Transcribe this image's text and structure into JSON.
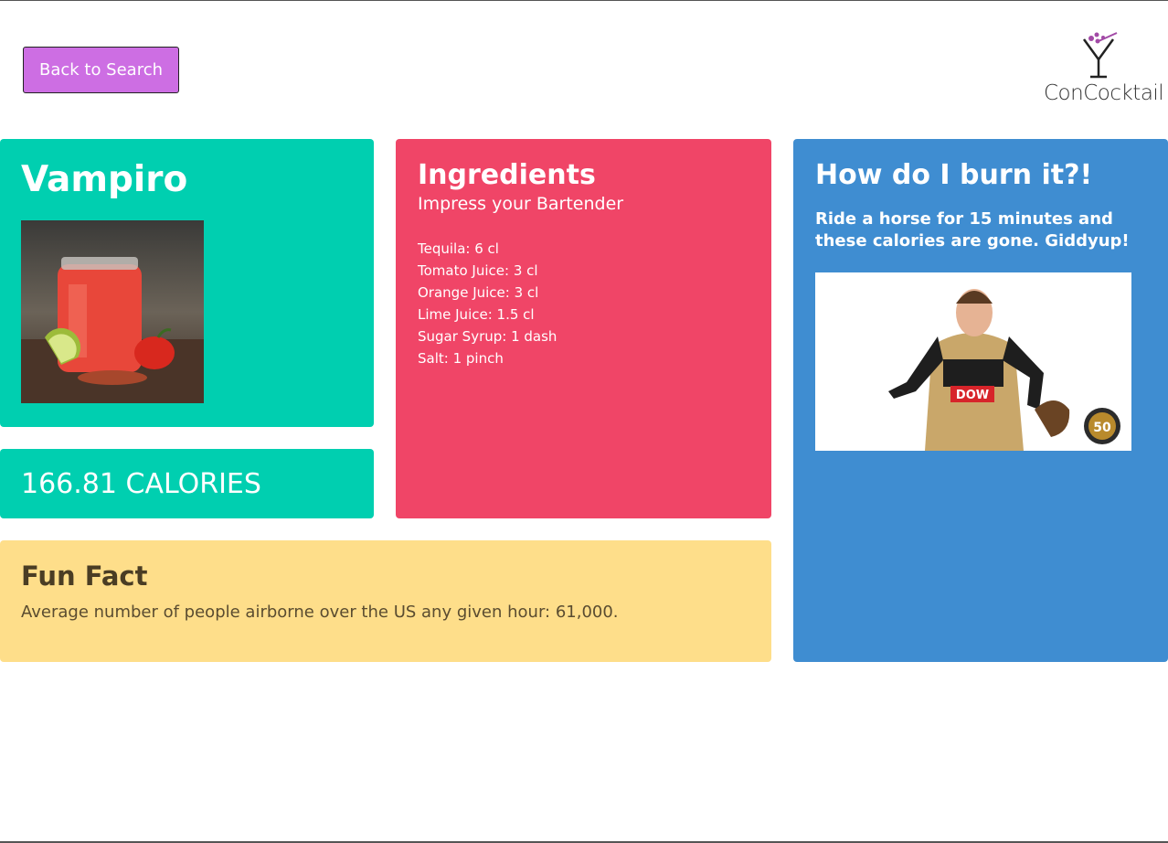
{
  "header": {
    "back_label": "Back to Search",
    "logo_text": "ConCocktail"
  },
  "drink": {
    "name": "Vampiro",
    "calories": "166.81 CALORIES"
  },
  "ingredients": {
    "title": "Ingredients",
    "subtitle": "Impress your Bartender",
    "items": [
      "Tequila: 6 cl",
      "Tomato Juice: 3 cl",
      "Orange Juice: 3 cl",
      "Lime Juice: 1.5 cl",
      "Sugar Syrup: 1 dash",
      "Salt: 1 pinch"
    ]
  },
  "burn": {
    "title": "How do I burn it?!",
    "text": "Ride a horse for 15 minutes and these calories are gone. Giddyup!",
    "badge_number": "50"
  },
  "fun_fact": {
    "title": "Fun Fact",
    "text": "Average number of people airborne over the US any given hour: 61,000."
  },
  "colors": {
    "accent_button": "#cd6ee3",
    "teal": "#00cfb0",
    "pink": "#f04567",
    "blue": "#3f8dd1",
    "yellow": "#fede8a"
  }
}
